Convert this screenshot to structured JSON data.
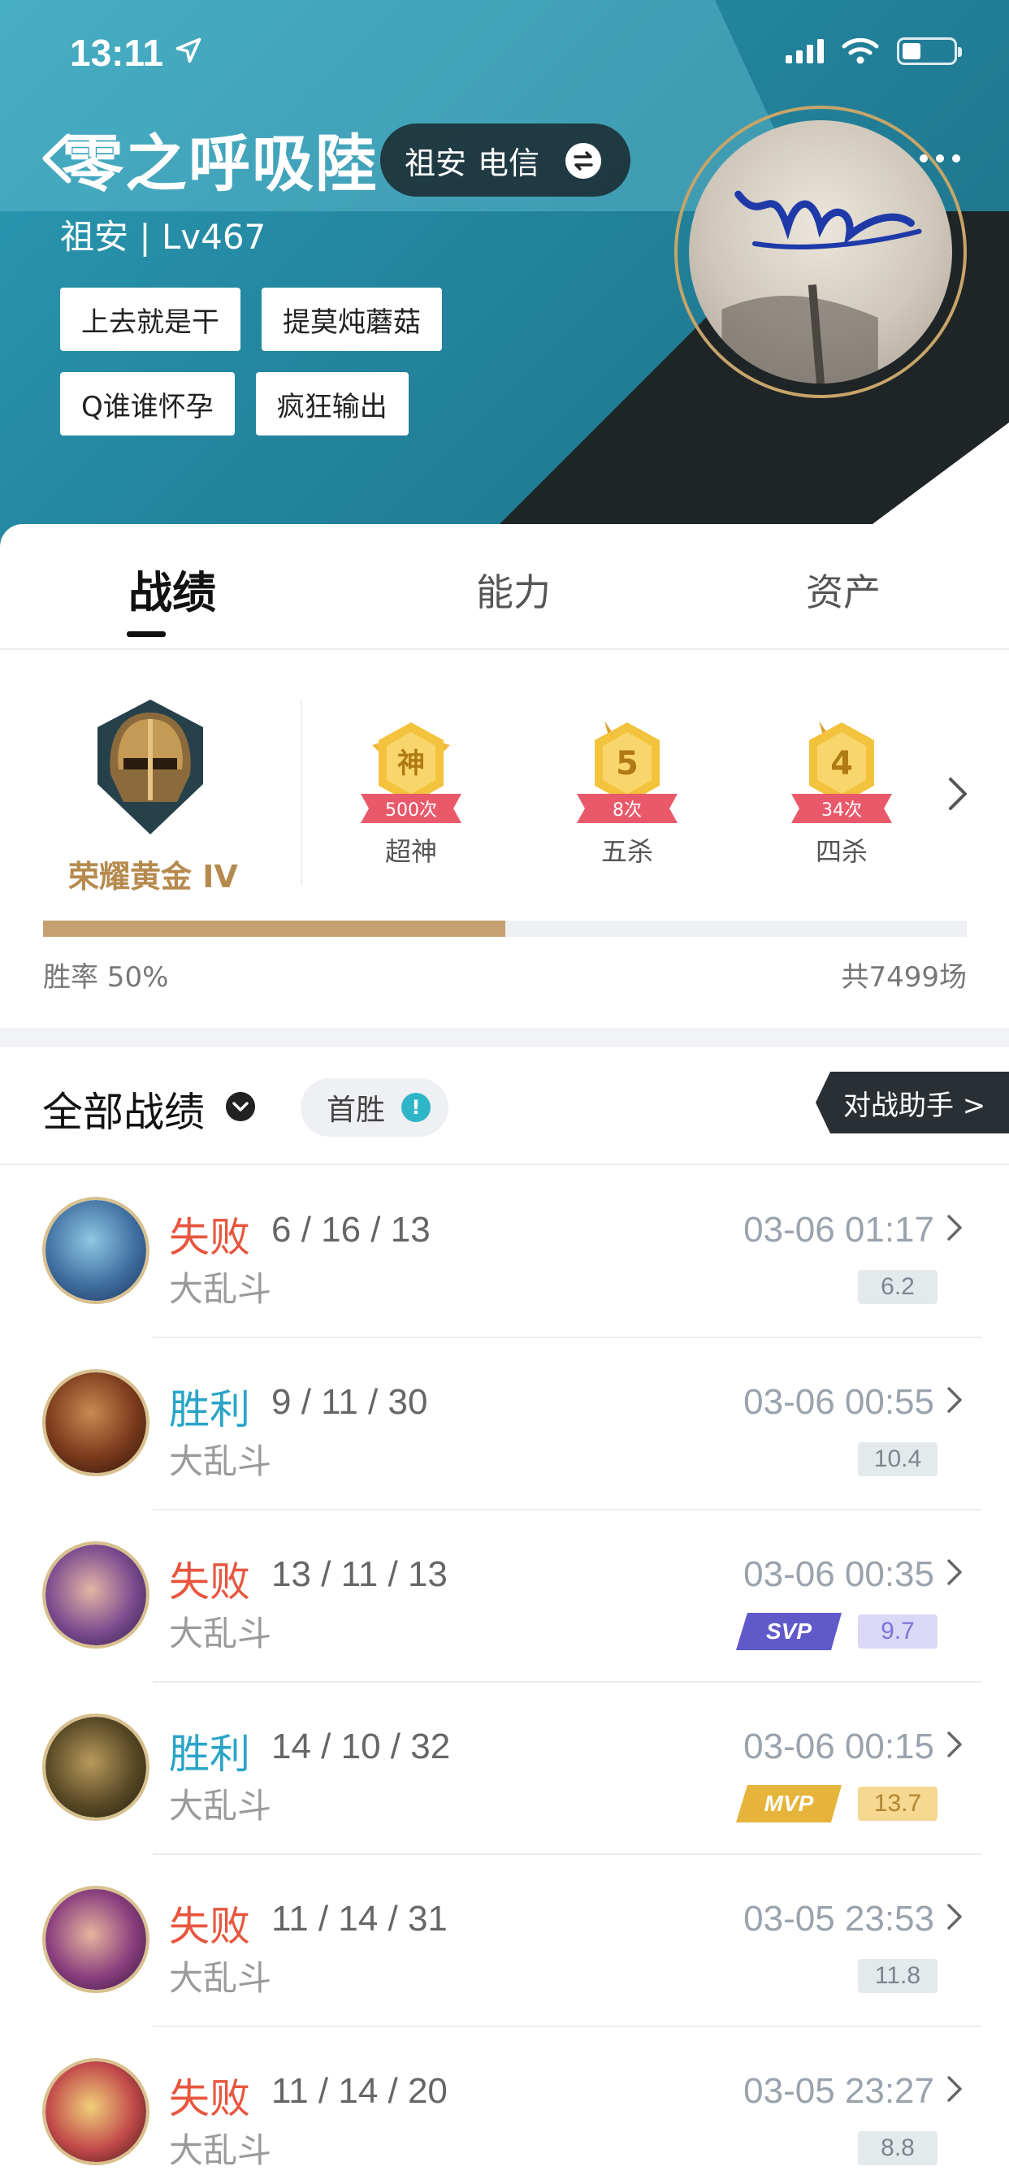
{
  "status_bar": {
    "time": "13:11"
  },
  "profile": {
    "name": "零之呼吸陸",
    "server_region": "祖安",
    "server_carrier": "电信",
    "level_line": "祖安 | Lv467",
    "tags": [
      "上去就是干",
      "提莫炖蘑菇",
      "Q谁谁怀孕",
      "疯狂输出"
    ]
  },
  "tabs": [
    {
      "label": "战绩",
      "active": true
    },
    {
      "label": "能力",
      "active": false
    },
    {
      "label": "资产",
      "active": false
    }
  ],
  "rank": {
    "name": "荣耀黄金 IV"
  },
  "honors": [
    {
      "icon_text": "神",
      "count": "500次",
      "label": "超神"
    },
    {
      "icon_text": "5",
      "count": "8次",
      "label": "五杀"
    },
    {
      "icon_text": "4",
      "count": "34次",
      "label": "四杀"
    }
  ],
  "win_rate": {
    "text": "胜率 50%",
    "value": 0.5
  },
  "total_games": "共7499场",
  "filter": {
    "title": "全部战绩",
    "first_win": "首胜",
    "first_win_icon": "!",
    "assistant": "对战助手 >"
  },
  "matches": [
    {
      "result": "失败",
      "outcome": "lose",
      "kda": "6 / 16 / 13",
      "mode": "大乱斗",
      "time": "03-06 01:17",
      "score": "6.2",
      "badge": "",
      "badge_type": ""
    },
    {
      "result": "胜利",
      "outcome": "win",
      "kda": "9 / 11 / 30",
      "mode": "大乱斗",
      "time": "03-06 00:55",
      "score": "10.4",
      "badge": "",
      "badge_type": ""
    },
    {
      "result": "失败",
      "outcome": "lose",
      "kda": "13 / 11 / 13",
      "mode": "大乱斗",
      "time": "03-06 00:35",
      "score": "9.7",
      "badge": "SVP",
      "badge_type": "svp"
    },
    {
      "result": "胜利",
      "outcome": "win",
      "kda": "14 / 10 / 32",
      "mode": "大乱斗",
      "time": "03-06 00:15",
      "score": "13.7",
      "badge": "MVP",
      "badge_type": "mvp"
    },
    {
      "result": "失败",
      "outcome": "lose",
      "kda": "11 / 14 / 31",
      "mode": "大乱斗",
      "time": "03-05 23:53",
      "score": "11.8",
      "badge": "",
      "badge_type": ""
    },
    {
      "result": "失败",
      "outcome": "lose",
      "kda": "11 / 14 / 20",
      "mode": "大乱斗",
      "time": "03-05 23:27",
      "score": "8.8",
      "badge": "",
      "badge_type": ""
    }
  ],
  "colors": {
    "header_teal": "#2486a0",
    "lose": "#e8553e",
    "win": "#2aa4c6",
    "gold": "#c6a071"
  }
}
